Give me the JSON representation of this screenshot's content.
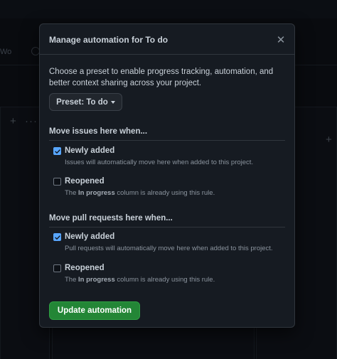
{
  "background": {
    "tab_text": "Wo",
    "plus": "+",
    "dots": "···"
  },
  "modal": {
    "title": "Manage automation for To do",
    "close_glyph": "✕",
    "intro": "Choose a preset to enable progress tracking, automation, and better context sharing across your project.",
    "preset": {
      "label": "Preset: To do"
    },
    "issues_section": {
      "heading": "Move issues here when...",
      "options": [
        {
          "label": "Newly added",
          "checked": true,
          "description": "Issues will automatically move here when added to this project."
        },
        {
          "label": "Reopened",
          "checked": false,
          "description_prefix": "The ",
          "description_bold": "In progress",
          "description_suffix": " column is already using this rule."
        }
      ]
    },
    "prs_section": {
      "heading": "Move pull requests here when...",
      "options": [
        {
          "label": "Newly added",
          "checked": true,
          "description": "Pull requests will automatically move here when added to this project."
        },
        {
          "label": "Reopened",
          "checked": false,
          "description_prefix": "The ",
          "description_bold": "In progress",
          "description_suffix": " column is already using this rule."
        }
      ]
    },
    "submit_label": "Update automation"
  },
  "colors": {
    "accent_blue": "#58a6ff",
    "primary_green": "#238636",
    "panel_bg": "#161b22"
  }
}
